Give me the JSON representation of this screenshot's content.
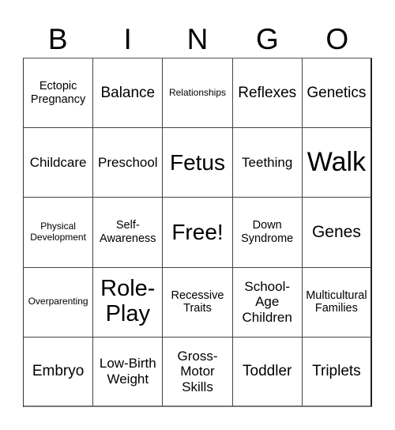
{
  "header": {
    "letters": [
      "B",
      "I",
      "N",
      "G",
      "O"
    ]
  },
  "board": {
    "rows": [
      [
        "Ectopic Pregnancy",
        "Balance",
        "Relationships",
        "Reflexes",
        "Genetics"
      ],
      [
        "Childcare",
        "Preschool",
        "Fetus",
        "Teething",
        "Walk"
      ],
      [
        "Physical Development",
        "Self-Awareness",
        "Free!",
        "Down Syndrome",
        "Genes"
      ],
      [
        "Overparenting",
        "Role-Play",
        "Recessive Traits",
        "School-Age Children",
        "Multicultural Families"
      ],
      [
        "Embryo",
        "Low-Birth Weight",
        "Gross-Motor Skills",
        "Toddler",
        "Triplets"
      ]
    ],
    "free_space": "Free!"
  }
}
